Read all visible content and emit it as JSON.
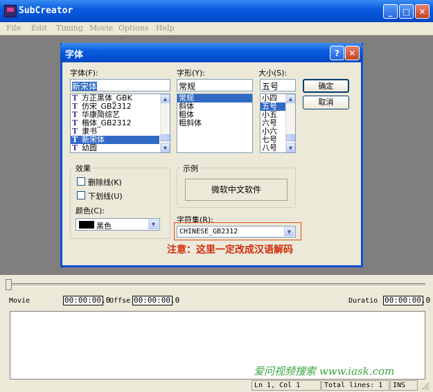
{
  "window": {
    "title": "SubCreator",
    "minimize": "_",
    "maximize": "□",
    "close": "✕"
  },
  "menu": [
    "File",
    "Edit",
    "Timing",
    "Movie",
    "Options",
    "Help"
  ],
  "dialog": {
    "title": "字体",
    "help_button": "?",
    "close_button": "✕",
    "font_label": "字体(F):",
    "font_value": "新宋体",
    "font_list": [
      "方正黑体_GBK",
      "仿宋_GB2312",
      "华康简综艺",
      "楷体_GB2312",
      "隶书",
      "新宋体",
      "幼圆"
    ],
    "font_selected_index": 5,
    "style_label": "字形(Y):",
    "style_value": "常规",
    "style_list": [
      "常规",
      "斜体",
      "粗体",
      "粗斜体"
    ],
    "size_label": "大小(S):",
    "size_value": "五号",
    "size_list": [
      "小四",
      "五号",
      "小五",
      "六号",
      "小六",
      "七号",
      "八号"
    ],
    "ok_button": "确定",
    "cancel_button": "取消",
    "effects": {
      "title": "效果",
      "strikeout_label": "删除线(K)",
      "underline_label": "下划线(U)",
      "color_label": "颜色(C):",
      "color_value": "黑色",
      "color_swatch": "#000000"
    },
    "sample": {
      "title": "示例",
      "text": "微软中文软件"
    },
    "charset_label": "字符集(R):",
    "charset_value": "CHINESE_GB2312",
    "annotation": "注意：这里一定改成汉语解码"
  },
  "timeline": {
    "movie_label": "Movie",
    "movie_time": "00:00:00.0",
    "offset_label": "Offse",
    "offset_time": "00:00:00.0",
    "duration_label": "Duratio",
    "duration_time": "00:00:00.0"
  },
  "watermark": "爱问视频搜索 www.iask.com",
  "status": {
    "position": "Ln 1, Col 1",
    "total": "Total lines: 1",
    "mode": "INS"
  },
  "colors": {
    "titlebar": "#0552d6",
    "annotation": "#d22a0a",
    "watermark": "#3aa640",
    "selection": "#316ac5"
  }
}
